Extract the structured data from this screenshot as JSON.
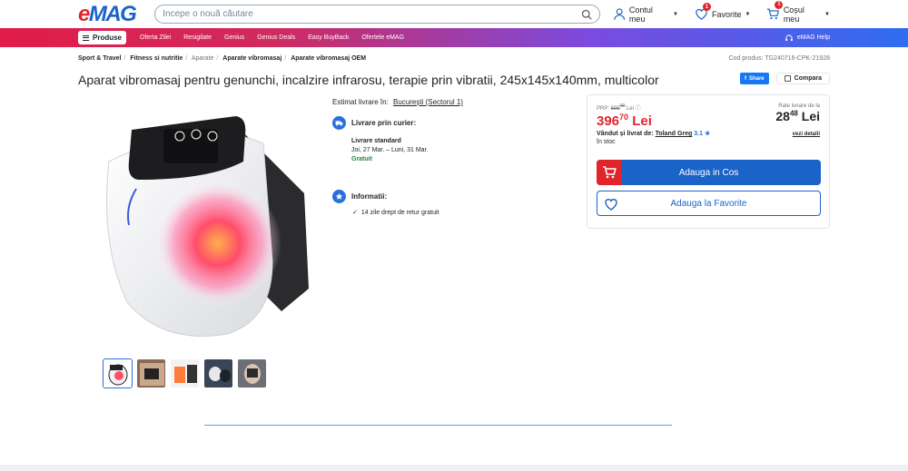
{
  "header": {
    "logo": "eMAG",
    "search_placeholder": "Începe o nouă căutare",
    "account_label": "Contul meu",
    "favorites_label": "Favorite",
    "favorites_count": "1",
    "cart_label": "Coșul meu",
    "cart_count": "1"
  },
  "nav": {
    "products_label": "Produse",
    "links": [
      "Oferta Zilei",
      "Resigilate",
      "Genius",
      "Genius Deals",
      "Easy BuyBack",
      "Ofertele eMAG"
    ],
    "help_label": "eMAG Help"
  },
  "breadcrumb": {
    "items": [
      "Sport & Travel",
      "Fitness si nutritie",
      "Aparate",
      "Aparate vibromasaj",
      "Aparate vibromasaj OEM"
    ],
    "product_code": "Cod produs: TG240716-CPK-21928"
  },
  "product": {
    "title": "Aparat vibromasaj pentru genunchi, incalzire infrarosu, terapie prin vibratii, 245x145x140mm, multicolor",
    "share_label": "Share",
    "compare_label": "Compara"
  },
  "delivery": {
    "estimate_label": "Estimat livrare în:",
    "location": "București (Sectorul 1)",
    "courier_heading": "Livrare prin curier:",
    "standard_label": "Livrare standard",
    "dates": "Joi, 27 Mar. – Luni, 31 Mar.",
    "cost": "Gratuit",
    "info_heading": "Informatii:",
    "return_policy": "14 zile drept de retur gratuit"
  },
  "buybox": {
    "prp_label": "PRP:",
    "prp_value": "595",
    "prp_decimals": "00",
    "prp_currency": "Lei",
    "price_int": "396",
    "price_dec": "70",
    "price_currency": "Lei",
    "seller_label": "Vândut și livrat de:",
    "seller_name": "Toland Greg",
    "seller_rating": "3.1",
    "stock": "în stoc",
    "installment_label": "Rate lunare de la",
    "installment_int": "28",
    "installment_dec": "48",
    "installment_currency": "Lei",
    "installment_details": "vezi detalii",
    "add_to_cart": "Adauga in Cos",
    "add_to_favorites": "Adauga la Favorite"
  },
  "colors": {
    "brand_red": "#e0252b",
    "brand_blue": "#1a63c8",
    "success_green": "#1b8a3b"
  }
}
